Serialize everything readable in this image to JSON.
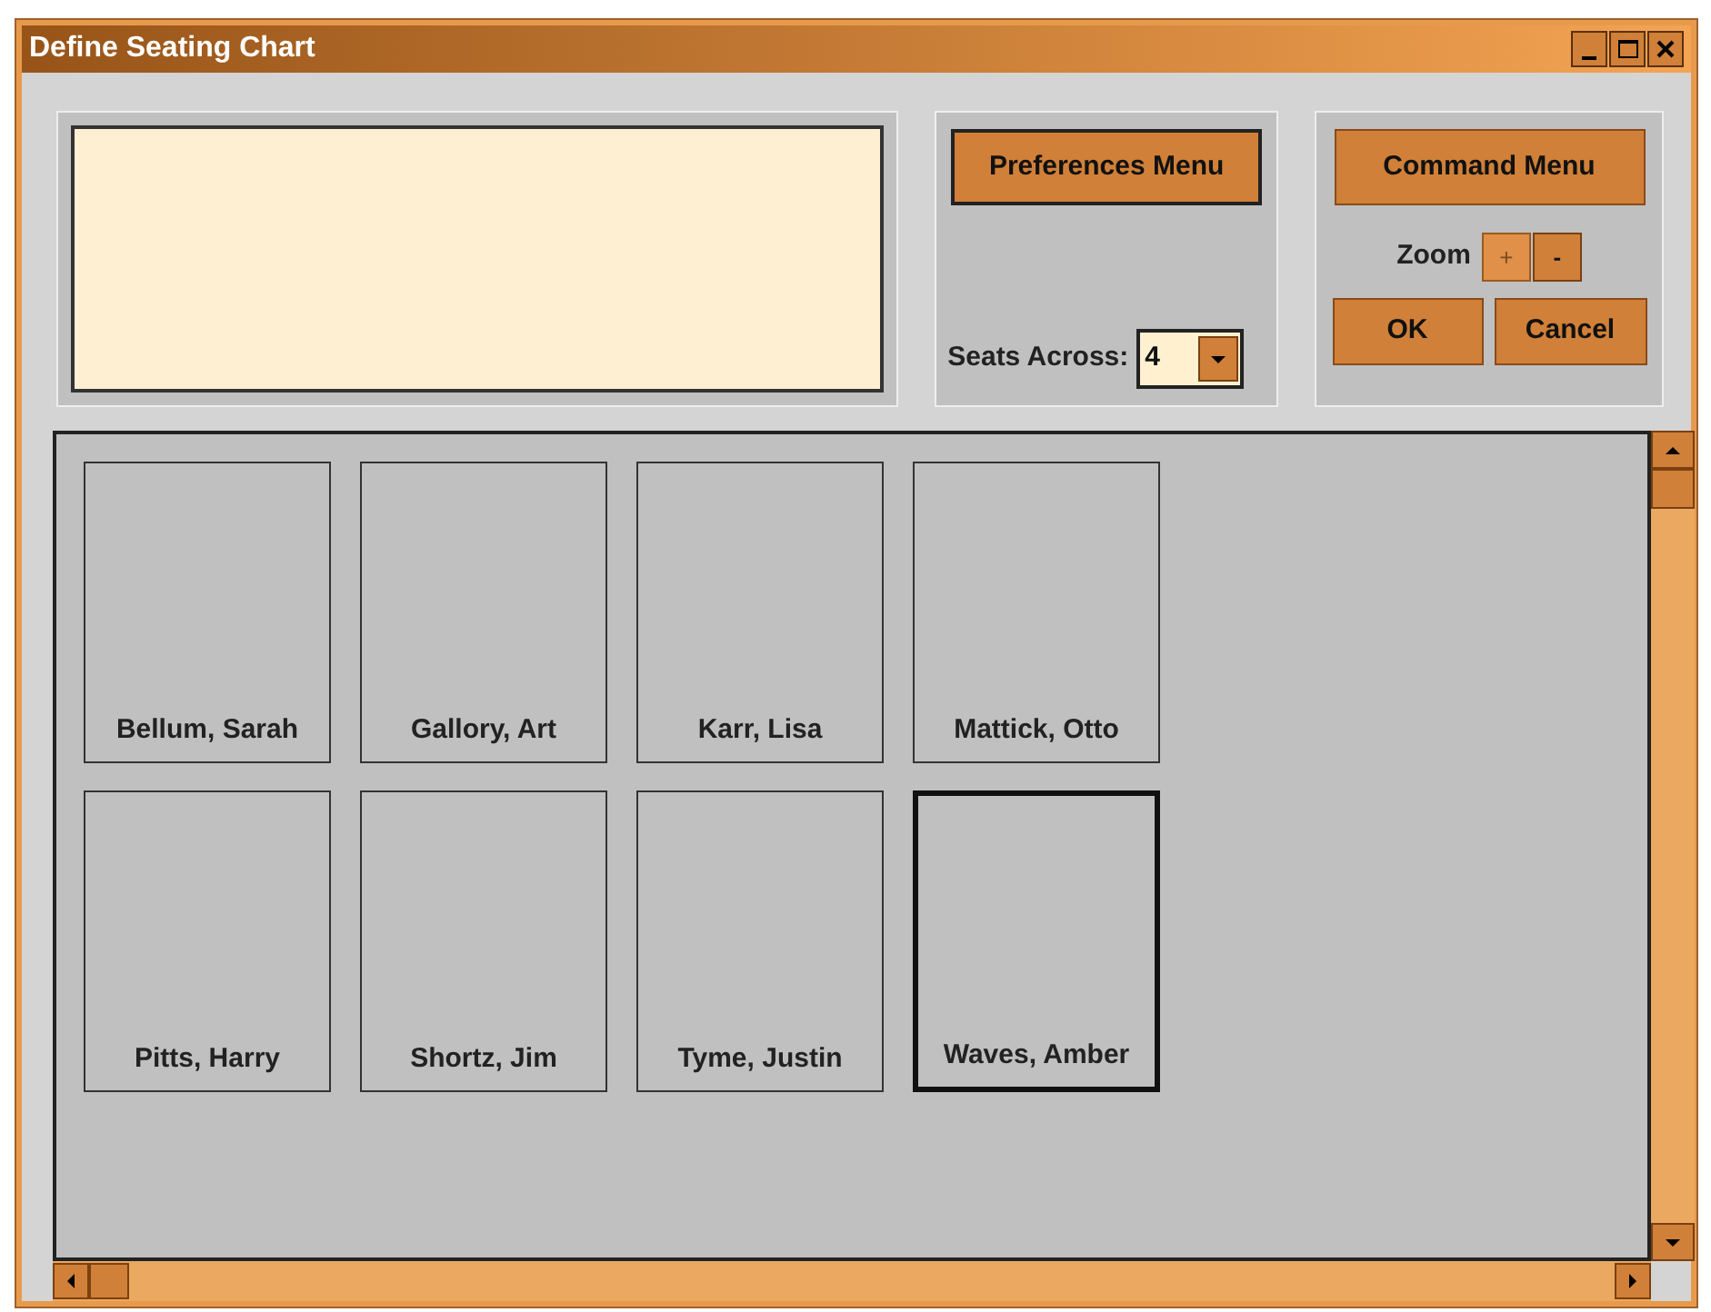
{
  "window": {
    "title": "Define Seating Chart"
  },
  "preferences_button": {
    "label": "Preferences Menu"
  },
  "seats_across": {
    "label": "Seats Across:",
    "value": "4"
  },
  "command_button": {
    "label": "Command Menu"
  },
  "zoom": {
    "label": "Zoom",
    "buttons": [
      {
        "label": "+",
        "disabled": true
      },
      {
        "label": "-",
        "disabled": false
      }
    ]
  },
  "dialog_buttons": [
    "OK",
    "Cancel"
  ],
  "seats": [
    {
      "name": "Bellum, Sarah",
      "selected": false
    },
    {
      "name": "Gallory, Art",
      "selected": false
    },
    {
      "name": "Karr, Lisa",
      "selected": false
    },
    {
      "name": "Mattick, Otto",
      "selected": false
    },
    {
      "name": "Pitts, Harry",
      "selected": false
    },
    {
      "name": "Shortz, Jim",
      "selected": false
    },
    {
      "name": "Tyme, Justin",
      "selected": false
    },
    {
      "name": "Waves, Amber",
      "selected": true
    }
  ]
}
